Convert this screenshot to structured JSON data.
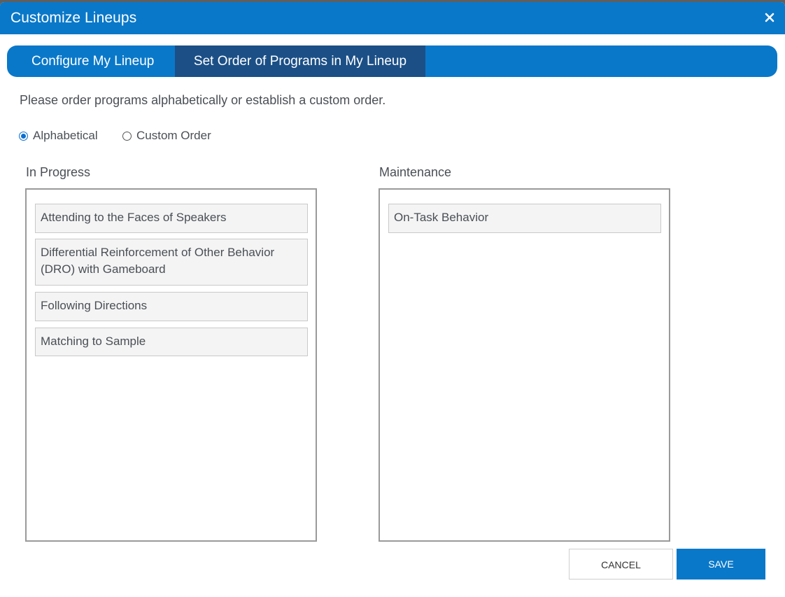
{
  "dialog": {
    "title": "Customize Lineups",
    "close_icon": "close-icon"
  },
  "tabs": [
    {
      "label": "Configure My Lineup",
      "active": false
    },
    {
      "label": "Set Order of Programs in My Lineup",
      "active": true
    }
  ],
  "instruction": "Please order programs alphabetically or establish a custom order.",
  "order_options": [
    {
      "label": "Alphabetical",
      "selected": true
    },
    {
      "label": "Custom Order",
      "selected": false
    }
  ],
  "columns": {
    "in_progress": {
      "heading": "In Progress",
      "items": [
        "Attending to the Faces of Speakers",
        "Differential Reinforcement of Other Behavior (DRO) with Gameboard",
        "Following Directions",
        "Matching to Sample"
      ]
    },
    "maintenance": {
      "heading": "Maintenance",
      "items": [
        "On-Task Behavior"
      ]
    }
  },
  "buttons": {
    "cancel": "CANCEL",
    "save": "SAVE"
  },
  "colors": {
    "primary": "#0a78c9",
    "active_tab": "#1b4f86",
    "radio": "#0a6fd1"
  }
}
